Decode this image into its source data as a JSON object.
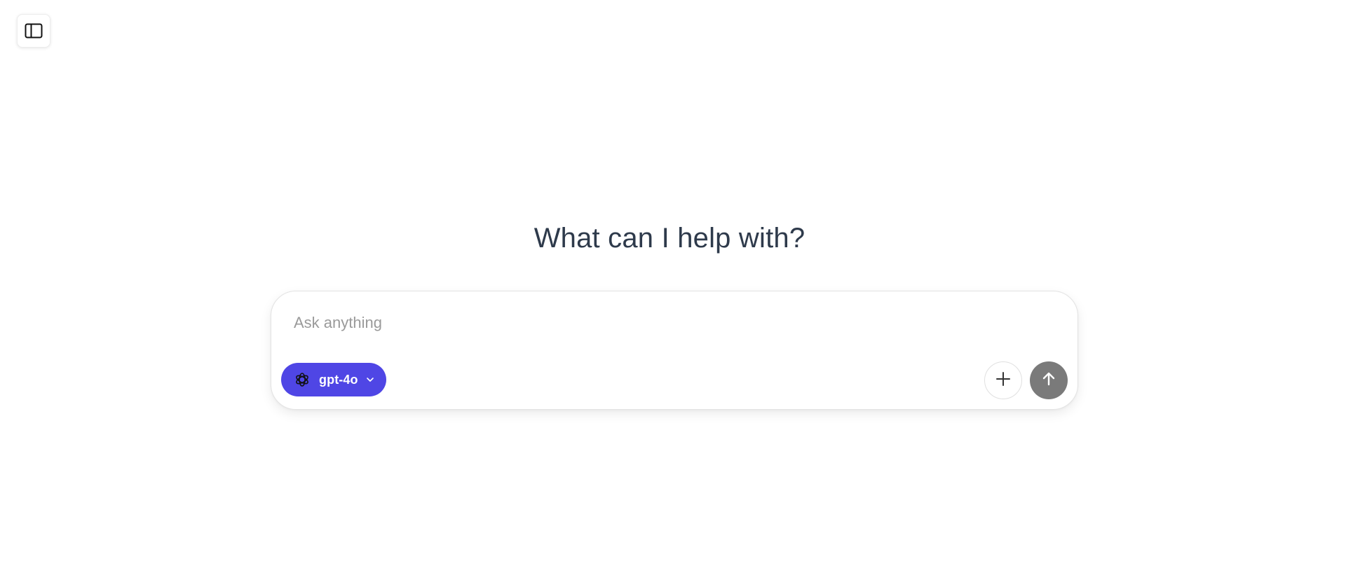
{
  "header": {
    "sidebar_toggle_icon": "sidebar-toggle-icon"
  },
  "main": {
    "heading": "What can I help with?"
  },
  "composer": {
    "placeholder": "Ask anything",
    "value": "",
    "model_selector": {
      "label": "gpt-4o",
      "icon": "openai-logo-icon",
      "dropdown_icon": "chevron-down-icon",
      "background_color": "#4f46e5"
    },
    "attach_button": {
      "icon": "plus-icon"
    },
    "send_button": {
      "icon": "arrow-up-icon",
      "color": "#7a7a7a"
    }
  }
}
